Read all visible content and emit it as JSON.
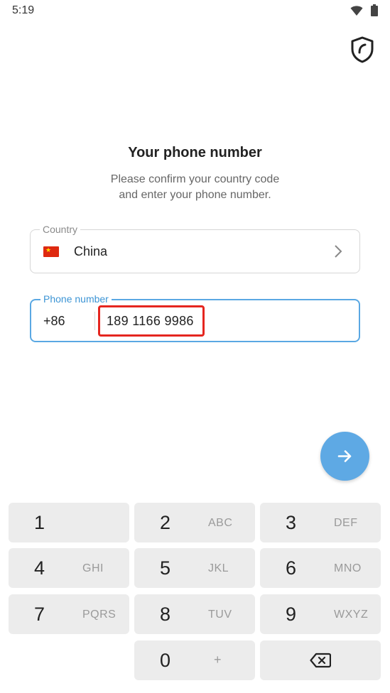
{
  "status_bar": {
    "time": "5:19",
    "icons": [
      "wifi-icon",
      "battery-icon"
    ]
  },
  "header": {
    "shield_icon": "shield-icon"
  },
  "page": {
    "title": "Your phone number",
    "subtitle_line1": "Please confirm your country code",
    "subtitle_line2": "and enter your phone number."
  },
  "country": {
    "label": "Country",
    "value": "China",
    "flag": "china-flag",
    "flag_star": "★"
  },
  "phone": {
    "label": "Phone number",
    "code": "+86",
    "number": "189 1166 9986"
  },
  "fab": {
    "icon": "arrow-right-icon"
  },
  "keypad": {
    "keys": [
      {
        "digit": "1",
        "letters": ""
      },
      {
        "digit": "2",
        "letters": "ABC"
      },
      {
        "digit": "3",
        "letters": "DEF"
      },
      {
        "digit": "4",
        "letters": "GHI"
      },
      {
        "digit": "5",
        "letters": "JKL"
      },
      {
        "digit": "6",
        "letters": "MNO"
      },
      {
        "digit": "7",
        "letters": "PQRS"
      },
      {
        "digit": "8",
        "letters": "TUV"
      },
      {
        "digit": "9",
        "letters": "WXYZ"
      },
      {
        "digit": "0",
        "letters": "+"
      }
    ],
    "backspace_icon": "backspace-icon"
  },
  "colors": {
    "accent": "#5ea9e4",
    "highlight": "#e5261f",
    "key_bg": "#ececec"
  }
}
